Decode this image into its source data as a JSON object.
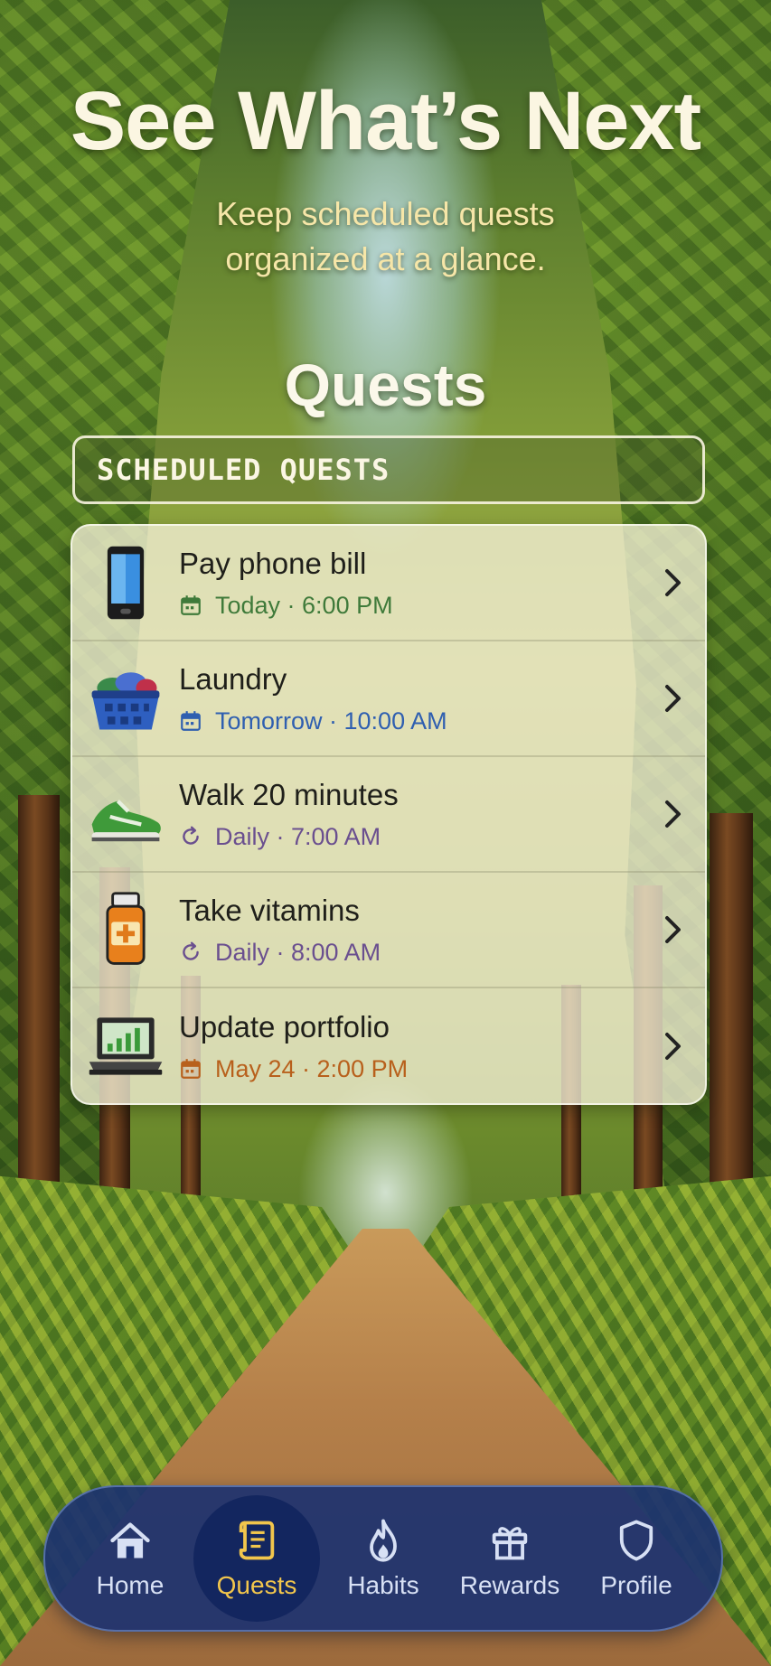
{
  "hero": {
    "title": "See What’s Next",
    "subtitle_line1": "Keep scheduled quests",
    "subtitle_line2": "organized at a glance."
  },
  "screen": {
    "title": "Quests",
    "section_header": "SCHEDULED QUESTS"
  },
  "quests": [
    {
      "title": "Pay phone bill",
      "meta": "Today · 6:00 PM",
      "meta_icon": "calendar-icon",
      "icon": "phone-icon",
      "color": "#3f7a3a"
    },
    {
      "title": "Laundry",
      "meta": "Tomorrow · 10:00 AM",
      "meta_icon": "calendar-icon",
      "icon": "laundry-basket-icon",
      "color": "#2f5fb0"
    },
    {
      "title": "Walk 20 minutes",
      "meta": "Daily · 7:00 AM",
      "meta_icon": "repeat-icon",
      "icon": "sneaker-icon",
      "color": "#6a4f8f"
    },
    {
      "title": "Take vitamins",
      "meta": "Daily · 8:00 AM",
      "meta_icon": "repeat-icon",
      "icon": "vitamin-bottle-icon",
      "color": "#6a4f8f"
    },
    {
      "title": "Update portfolio",
      "meta": "May 24 · 2:00 PM",
      "meta_icon": "calendar-icon",
      "icon": "laptop-chart-icon",
      "color": "#b8601c"
    }
  ],
  "nav": {
    "items": [
      {
        "label": "Home",
        "icon": "home-icon"
      },
      {
        "label": "Quests",
        "icon": "scroll-icon",
        "active": true
      },
      {
        "label": "Habits",
        "icon": "flame-icon"
      },
      {
        "label": "Rewards",
        "icon": "gift-icon"
      },
      {
        "label": "Profile",
        "icon": "shield-icon"
      }
    ],
    "active_color": "#f2c64c",
    "bar_color": "#1c3270"
  }
}
